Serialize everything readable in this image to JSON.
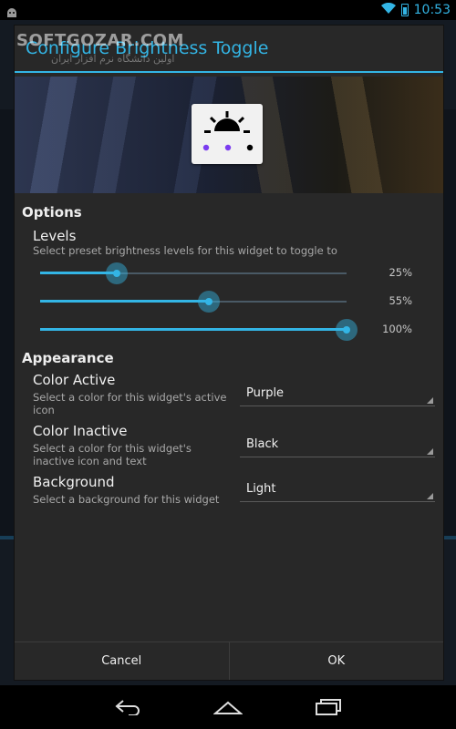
{
  "status": {
    "time": "10:53"
  },
  "watermark": {
    "text": "SOFTGOZAR.COM",
    "subtext": "اولین دانشگاه نرم افزار ایران"
  },
  "dialog": {
    "title": "Configure Brightness Toggle",
    "preview": {
      "dots": [
        "#7b3cf0",
        "#7b3cf0",
        "#000000"
      ]
    },
    "options_header": "Options",
    "levels": {
      "title": "Levels",
      "subtitle": "Select preset brightness levels for this widget to toggle to",
      "sliders": [
        {
          "label": "25%",
          "value": 25
        },
        {
          "label": "55%",
          "value": 55
        },
        {
          "label": "100%",
          "value": 100
        }
      ]
    },
    "appearance_header": "Appearance",
    "settings": [
      {
        "title": "Color Active",
        "subtitle": "Select a color for this widget's active icon",
        "value": "Purple"
      },
      {
        "title": "Color Inactive",
        "subtitle": "Select a color for this widget's inactive icon and text",
        "value": "Black"
      },
      {
        "title": "Background",
        "subtitle": "Select a background for this widget",
        "value": "Light"
      }
    ],
    "buttons": {
      "cancel": "Cancel",
      "ok": "OK"
    }
  },
  "colors": {
    "accent": "#33b5e5",
    "dialog_bg": "#282828"
  },
  "icons": [
    "wifi-icon",
    "battery-icon",
    "back-icon",
    "home-icon",
    "recent-apps-icon",
    "brightness-icon"
  ]
}
